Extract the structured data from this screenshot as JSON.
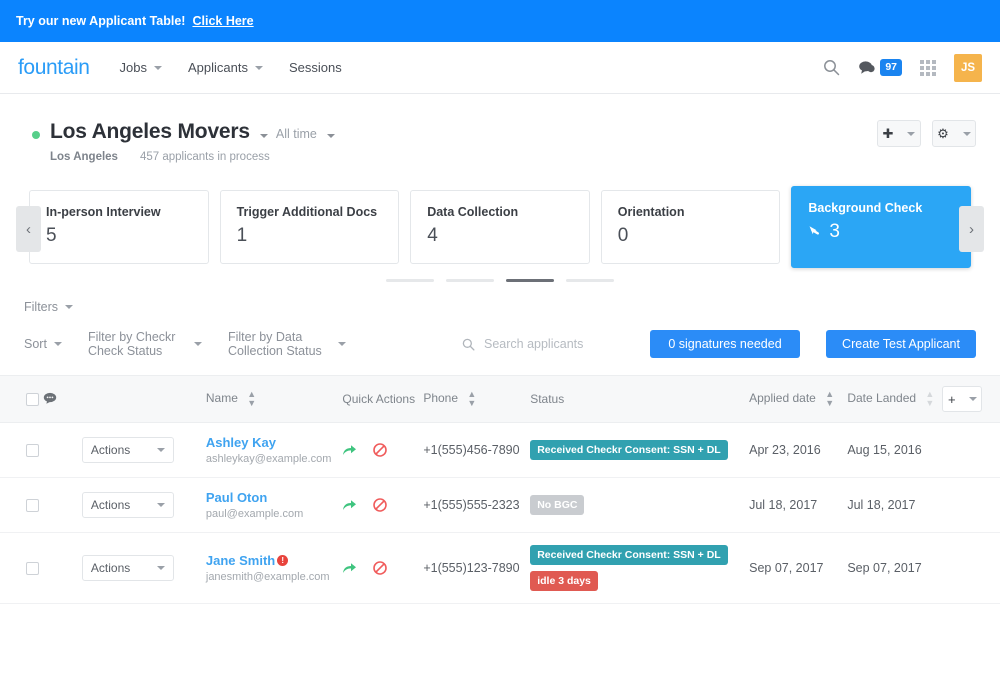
{
  "announcement": {
    "text": "Try our new Applicant Table!",
    "link_label": "Click Here"
  },
  "topnav": {
    "logo": "fountain",
    "links": [
      {
        "label": "Jobs",
        "has_caret": true
      },
      {
        "label": "Applicants",
        "has_caret": true
      },
      {
        "label": "Sessions",
        "has_caret": false
      }
    ],
    "search_icon": "search-icon",
    "messages_icon": "chat-bubble-icon",
    "messages_count": "97",
    "apps_icon": "grid-apps-icon",
    "avatar_initials": "JS"
  },
  "job": {
    "status_dot_color": "#57cf8a",
    "title": "Los Angeles Movers",
    "time_filter": "All time",
    "location": "Los Angeles",
    "applicants_in_process": "457 applicants in process",
    "add_button": "+",
    "settings_button": "gear"
  },
  "stages": {
    "prev_label": "‹",
    "next_label": "›",
    "items": [
      {
        "name": "In-person Interview",
        "count": "5",
        "active": false
      },
      {
        "name": "Trigger Additional Docs",
        "count": "1",
        "active": false
      },
      {
        "name": "Data Collection",
        "count": "4",
        "active": false
      },
      {
        "name": "Orientation",
        "count": "0",
        "active": false
      },
      {
        "name": "Background Check",
        "count": "3",
        "active": true
      }
    ],
    "pagination": [
      false,
      false,
      true,
      false
    ]
  },
  "filters": {
    "filters_label": "Filters",
    "sort_label": "Sort",
    "checkr_filter_label": "Filter by Checkr Check Status",
    "data_collection_filter_label": "Filter by Data Collection Status",
    "search_placeholder": "Search applicants",
    "signatures_button": "0 signatures needed",
    "create_test_applicant_button": "Create Test Applicant"
  },
  "table": {
    "headers": {
      "chat": "chat-icon",
      "quick_actions": "Quick Actions",
      "name": "Name",
      "phone": "Phone",
      "status": "Status",
      "applied_date": "Applied date",
      "date_landed": "Date Landed",
      "add_column": "+"
    },
    "row_action_label": "Actions",
    "rows": [
      {
        "name": "Ashley Kay",
        "alert": false,
        "email": "ashleykay@example.com",
        "phone": "+1(555)456-7890",
        "badges": [
          {
            "label": "Received Checkr Consent: SSN + DL",
            "color": "teal"
          }
        ],
        "applied_date": "Apr 23, 2016",
        "date_landed": "Aug 15, 2016"
      },
      {
        "name": "Paul Oton",
        "alert": false,
        "email": "paul@example.com",
        "phone": "+1(555)555-2323",
        "badges": [
          {
            "label": "No BGC",
            "color": "gray"
          }
        ],
        "applied_date": "Jul 18, 2017",
        "date_landed": "Jul 18, 2017"
      },
      {
        "name": "Jane Smith",
        "alert": true,
        "email": "janesmith@example.com",
        "phone": "+1(555)123-7890",
        "badges": [
          {
            "label": "Received Checkr Consent: SSN + DL",
            "color": "teal"
          },
          {
            "label": "idle 3 days",
            "color": "red"
          }
        ],
        "applied_date": "Sep 07, 2017",
        "date_landed": "Sep 07, 2017"
      }
    ]
  },
  "colors": {
    "brand_blue": "#2b8cf7",
    "announce_blue": "#0b84fe",
    "active_stage": "#2ba6f5",
    "teal_badge": "#31a1b0",
    "red_badge": "#e05a52",
    "gray_badge": "#c9ccd0",
    "avatar_orange": "#f5b44c",
    "green_dot": "#57cf8a"
  }
}
